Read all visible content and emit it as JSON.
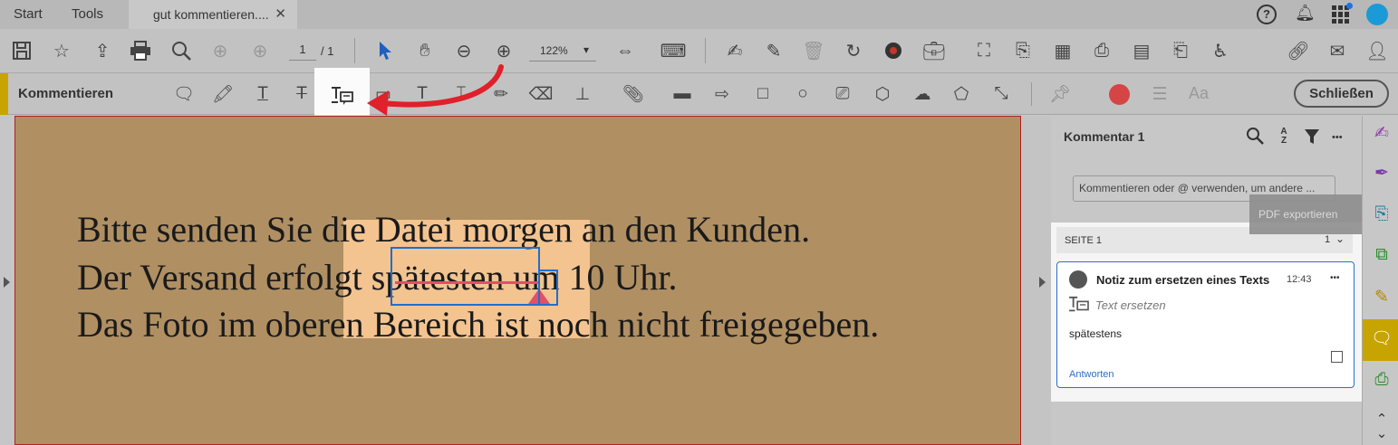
{
  "tabs": {
    "start": "Start",
    "tools": "Tools",
    "document": "gut kommentieren....",
    "close": "✕"
  },
  "toolbar": {
    "page_current": "1",
    "page_sep": "/ 1",
    "zoom": "122%",
    "zoom_caret": "▾"
  },
  "comment_bar": {
    "title": "Kommentieren",
    "close_label": "Schließen",
    "text_tool_label": "Aa"
  },
  "document": {
    "line1": "Bitte senden Sie die Datei morgen an den Kunden.",
    "line2": "Der Versand erfolgt spätesten um 10 Uhr.",
    "line3": "Das Foto im oberen Bereich ist noch nicht freigegeben."
  },
  "panel": {
    "title": "Kommentar 1",
    "sort_glyph": "A Z",
    "more": "•••",
    "input_placeholder": "Kommentieren oder @ verwenden, um andere ...",
    "tooltip": "PDF exportieren",
    "page_section": {
      "label": "SEITE 1",
      "count": "1"
    },
    "comment": {
      "title": "Notiz zum ersetzen eines Texts",
      "time": "12:43",
      "type": "Text ersetzen",
      "body": "spätestens",
      "reply": "Antworten",
      "more": "•••"
    }
  },
  "colors": {
    "accent": "#c8a400",
    "highlight": "#ffcc99",
    "page_bg": "#b08f62",
    "selection": "#1e6fd0",
    "strike": "#e05068",
    "arrow": "#e0202a",
    "link": "#2a6fc9"
  }
}
